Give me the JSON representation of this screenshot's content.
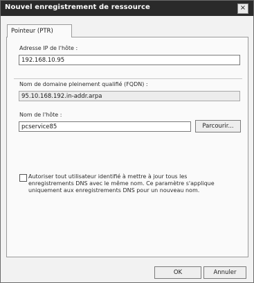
{
  "window": {
    "title": "Nouvel enregistrement de ressource",
    "close_glyph": "×"
  },
  "tabs": [
    {
      "label": "Pointeur (PTR)"
    }
  ],
  "form": {
    "host_ip_label": "Adresse IP de l'hôte :",
    "host_ip_value": "192.168.10.95",
    "fqdn_label": "Nom de domaine pleinement qualifié (FQDN) :",
    "fqdn_value": "95.10.168.192.in-addr.arpa",
    "hostname_label": "Nom de l'hôte :",
    "hostname_value": "pcservice85",
    "browse_button": "Parcourir..."
  },
  "checkbox": {
    "checked": false,
    "lines": [
      "Autoriser tout utilisateur identifié à mettre à jour tous les",
      "enregistrements DNS avec le même nom. Ce paramètre s'applique",
      "uniquement aux enregistrements DNS pour un nouveau nom."
    ]
  },
  "footer": {
    "ok_label": "OK",
    "cancel_label": "Annuler"
  }
}
